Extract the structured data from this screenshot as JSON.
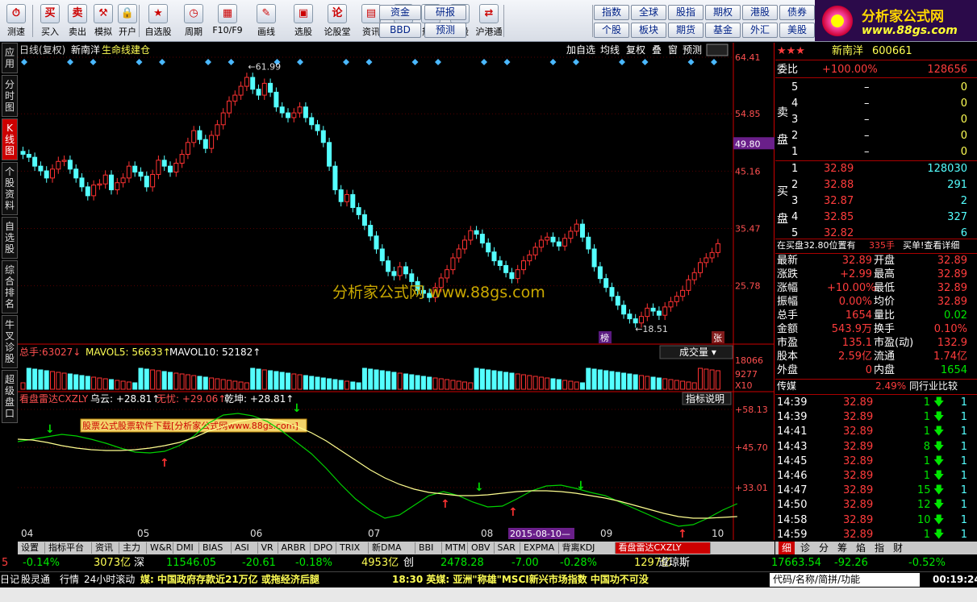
{
  "toolbar": {
    "items": [
      "测速",
      "买入",
      "卖出",
      "模拟",
      "开户",
      "自选股",
      "周期",
      "F10/F9",
      "画线",
      "选股",
      "论股堂",
      "资讯",
      "数据",
      "热点",
      "新股",
      "沪港通"
    ],
    "grid1": [
      "资金",
      "研报",
      "BBD",
      "预测"
    ],
    "grid2": [
      "指数",
      "全球",
      "股指",
      "期权",
      "港股",
      "债券",
      "个股",
      "板块",
      "期货",
      "基金",
      "外汇",
      "美股"
    ],
    "logo_cn": "分析家公式网",
    "logo_url": "www.88gs.com"
  },
  "left_tabs": [
    "应用",
    "分时图",
    "K线图",
    "个股资料",
    "自选股",
    "综合排名",
    "牛叉诊股",
    "超级盘口"
  ],
  "chart": {
    "header_left": "日线(复权)",
    "stock": "新南洋",
    "tag": "生命线建仓",
    "header_btns": [
      "加自选",
      "均线",
      "复权",
      "叠",
      "窗",
      "预测"
    ],
    "price_ticks": [
      "64.41",
      "54.85",
      "45.16",
      "35.47",
      "25.78"
    ],
    "marker_price": "49.80",
    "high_label": "61.99",
    "low_label": "18.51",
    "bang": "榜",
    "zhang": "张",
    "watermark": "分析家公式网    www.88gs.com",
    "vol_header": {
      "total_label": "总手:",
      "total": "63027",
      "mavol5_label": "MAVOL5:",
      "mavol5": "56633",
      "mavol10_label": "MAVOL10:",
      "mavol10": "52182"
    },
    "vol_btn": "成交量",
    "vol_ticks": [
      "18066",
      "9277",
      "X10"
    ],
    "ind_header": {
      "name": "看盘雷达CXZLY",
      "wuyun_label": "乌云:",
      "wuyun": "+28.81",
      "wuyou_label": "无忧:",
      "wuyou": "+29.06",
      "qiankun_label": "乾坤:",
      "qiankun": "+28.81"
    },
    "ind_btn": "指标说明",
    "ind_ticks": [
      "+58.13",
      "+45.70",
      "+33.01"
    ],
    "ad_banner": "股票公式股票软件下载[分析家公式网www.88gs.com]",
    "months": [
      "04",
      "05",
      "06",
      "07",
      "08",
      "09",
      "10"
    ],
    "cursor_date": "2015-08-10"
  },
  "chart_data": {
    "type": "candlestick",
    "y_range": [
      18.51,
      64.41
    ],
    "closes": [
      48,
      47.5,
      46,
      45.2,
      44,
      45.5,
      46.8,
      47,
      45.5,
      44,
      42.5,
      41,
      42.8,
      43,
      44.5,
      42,
      43.2,
      44,
      46,
      45,
      44.3,
      42.5,
      44.6,
      47,
      46,
      45,
      46.5,
      48,
      50,
      52,
      50.5,
      49,
      51.2,
      53,
      55,
      57,
      58,
      59.5,
      61,
      59,
      58,
      60,
      58.5,
      56,
      55,
      54.2,
      55,
      56,
      54.2,
      53,
      52,
      50,
      46,
      42,
      40,
      41.2,
      39,
      37.8,
      36,
      34.2,
      32,
      30,
      28.2,
      27.5,
      29,
      27.8,
      26.5,
      25,
      24.5,
      23.8,
      25.5,
      27.1,
      28.5,
      30.5,
      32,
      33.5,
      35.1,
      34.5,
      33,
      31.5,
      30,
      29.2,
      28,
      27,
      28.5,
      30,
      31,
      32.3,
      33.5,
      34,
      33.2,
      32.5,
      33.8,
      35,
      36.2,
      34,
      32,
      29,
      27,
      25.5,
      24,
      22.5,
      21,
      20.2,
      19.5,
      20.6,
      22,
      21.5,
      20.8,
      22.2,
      23.1,
      24,
      25,
      26.8,
      28,
      29.7,
      30.5,
      31.4,
      32.9
    ]
  },
  "right_panel": {
    "stars": "★★★",
    "name": "新南洋",
    "code": "600661",
    "weibi_label": "委比",
    "weibi": "+100.00%",
    "weicha": "128656",
    "sell_label": "卖盘",
    "buy_label": "买盘",
    "sell": [
      [
        "5",
        "–",
        "0"
      ],
      [
        "4",
        "–",
        "0"
      ],
      [
        "3",
        "–",
        "0"
      ],
      [
        "2",
        "–",
        "0"
      ],
      [
        "1",
        "–",
        "0"
      ]
    ],
    "buy": [
      [
        "1",
        "32.89",
        "128030"
      ],
      [
        "2",
        "32.88",
        "291"
      ],
      [
        "3",
        "32.87",
        "2"
      ],
      [
        "4",
        "32.85",
        "327"
      ],
      [
        "5",
        "32.82",
        "6"
      ]
    ],
    "note": "在买盘32.80位置有",
    "note_vol": "335手",
    "note_link": "买单!查看详细",
    "quotes": [
      [
        "最新",
        "32.89",
        "开盘",
        "32.89"
      ],
      [
        "涨跌",
        "+2.99",
        "最高",
        "32.89"
      ],
      [
        "涨幅",
        "+10.00%",
        "最低",
        "32.89"
      ],
      [
        "振幅",
        "0.00%",
        "均价",
        "32.89"
      ],
      [
        "总手",
        "1654",
        "量比",
        "0.02"
      ],
      [
        "金额",
        "543.9万",
        "换手",
        "0.10%"
      ],
      [
        "市盈",
        "135.1",
        "市盈(动)",
        "132.9"
      ],
      [
        "股本",
        "2.59亿",
        "流通",
        "1.74亿"
      ],
      [
        "外盘",
        "0",
        "内盘",
        "1654"
      ]
    ],
    "sector": "传媒",
    "sector_pct": "2.49%",
    "compare": "同行业比较",
    "ticks": [
      [
        "14:39",
        "32.89",
        "1"
      ],
      [
        "14:39",
        "32.89",
        "1"
      ],
      [
        "14:41",
        "32.89",
        "1"
      ],
      [
        "14:43",
        "32.89",
        "8"
      ],
      [
        "14:45",
        "32.89",
        "1"
      ],
      [
        "14:46",
        "32.89",
        "1"
      ],
      [
        "14:47",
        "32.89",
        "15"
      ],
      [
        "14:50",
        "32.89",
        "12"
      ],
      [
        "14:58",
        "32.89",
        "10"
      ],
      [
        "14:59",
        "32.89",
        "1"
      ]
    ],
    "tabs": [
      "细",
      "诊",
      "分",
      "筹",
      "焰",
      "指",
      "财"
    ]
  },
  "bottom_tabs": [
    "设置",
    "指标平台",
    "资讯",
    "主力",
    "W&R",
    "DMI",
    "BIAS",
    "ASI",
    "VR",
    "ARBR",
    "DPO",
    "TRIX",
    "新DMA",
    "BBI",
    "MTM",
    "OBV",
    "SAR",
    "EXPMA",
    "背离KDJ",
    "看盘雷达CXZLY"
  ],
  "status": [
    "-0.14%",
    "3073亿",
    "深",
    "11546.05",
    "-20.61",
    "-0.18%",
    "4953亿",
    "创",
    "2478.28",
    "-7.00",
    "-0.28%",
    "1297亿",
    "道琼斯",
    "17663.54",
    "-92.26",
    "-0.52%"
  ],
  "status_lead": "5",
  "bar2": {
    "items": [
      "日记",
      "股灵通",
      "行情",
      "24小时滚动"
    ],
    "news1": "媒: 中国政府存款近21万亿 或拖经济后腿",
    "news2": "18:30 英媒: 亚洲\"称雄\"MSCI新兴市场指数 中国功不可没",
    "search": "代码/名称/简拼/功能",
    "time": "00:19:24"
  }
}
